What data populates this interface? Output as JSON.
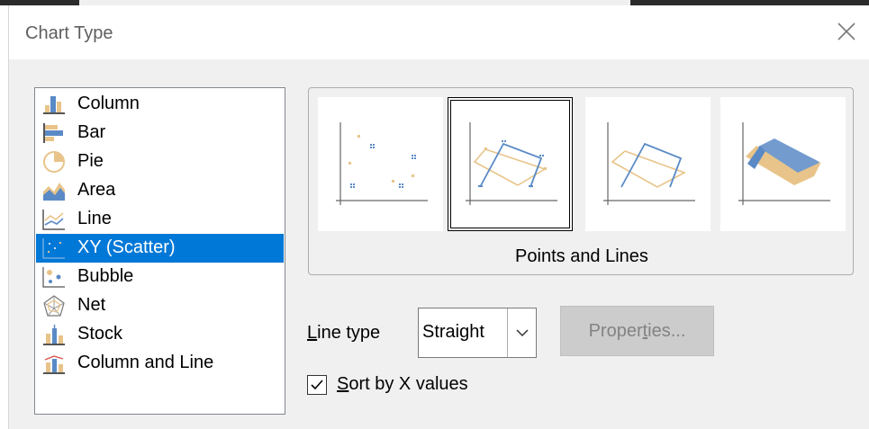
{
  "dialog": {
    "title": "Chart Type"
  },
  "chart_types": [
    {
      "label": "Column",
      "icon": "column-chart-icon",
      "selected": false
    },
    {
      "label": "Bar",
      "icon": "bar-chart-icon",
      "selected": false
    },
    {
      "label": "Pie",
      "icon": "pie-chart-icon",
      "selected": false
    },
    {
      "label": "Area",
      "icon": "area-chart-icon",
      "selected": false
    },
    {
      "label": "Line",
      "icon": "line-chart-icon",
      "selected": false
    },
    {
      "label": "XY (Scatter)",
      "icon": "scatter-chart-icon",
      "selected": true
    },
    {
      "label": "Bubble",
      "icon": "bubble-chart-icon",
      "selected": false
    },
    {
      "label": "Net",
      "icon": "net-chart-icon",
      "selected": false
    },
    {
      "label": "Stock",
      "icon": "stock-chart-icon",
      "selected": false
    },
    {
      "label": "Column and Line",
      "icon": "column-and-line-chart-icon",
      "selected": false
    }
  ],
  "variants": {
    "items": [
      "points-only-icon",
      "points-and-lines-icon",
      "lines-only-icon",
      "3d-lines-icon"
    ],
    "selected_index": 1,
    "selected_name": "Points and Lines"
  },
  "line_type": {
    "label_accel": "L",
    "label_rest": "ine type",
    "value": "Straight"
  },
  "properties_button": {
    "label_pre": "Proper",
    "label_accel": "t",
    "label_post": "ies...",
    "enabled": false
  },
  "sort_checkbox": {
    "checked": true,
    "label_accel": "S",
    "label_rest": "ort by X values"
  },
  "colors": {
    "accent": "#0078d7",
    "series_a": "#e8c48a",
    "series_b": "#5a8ac6"
  }
}
